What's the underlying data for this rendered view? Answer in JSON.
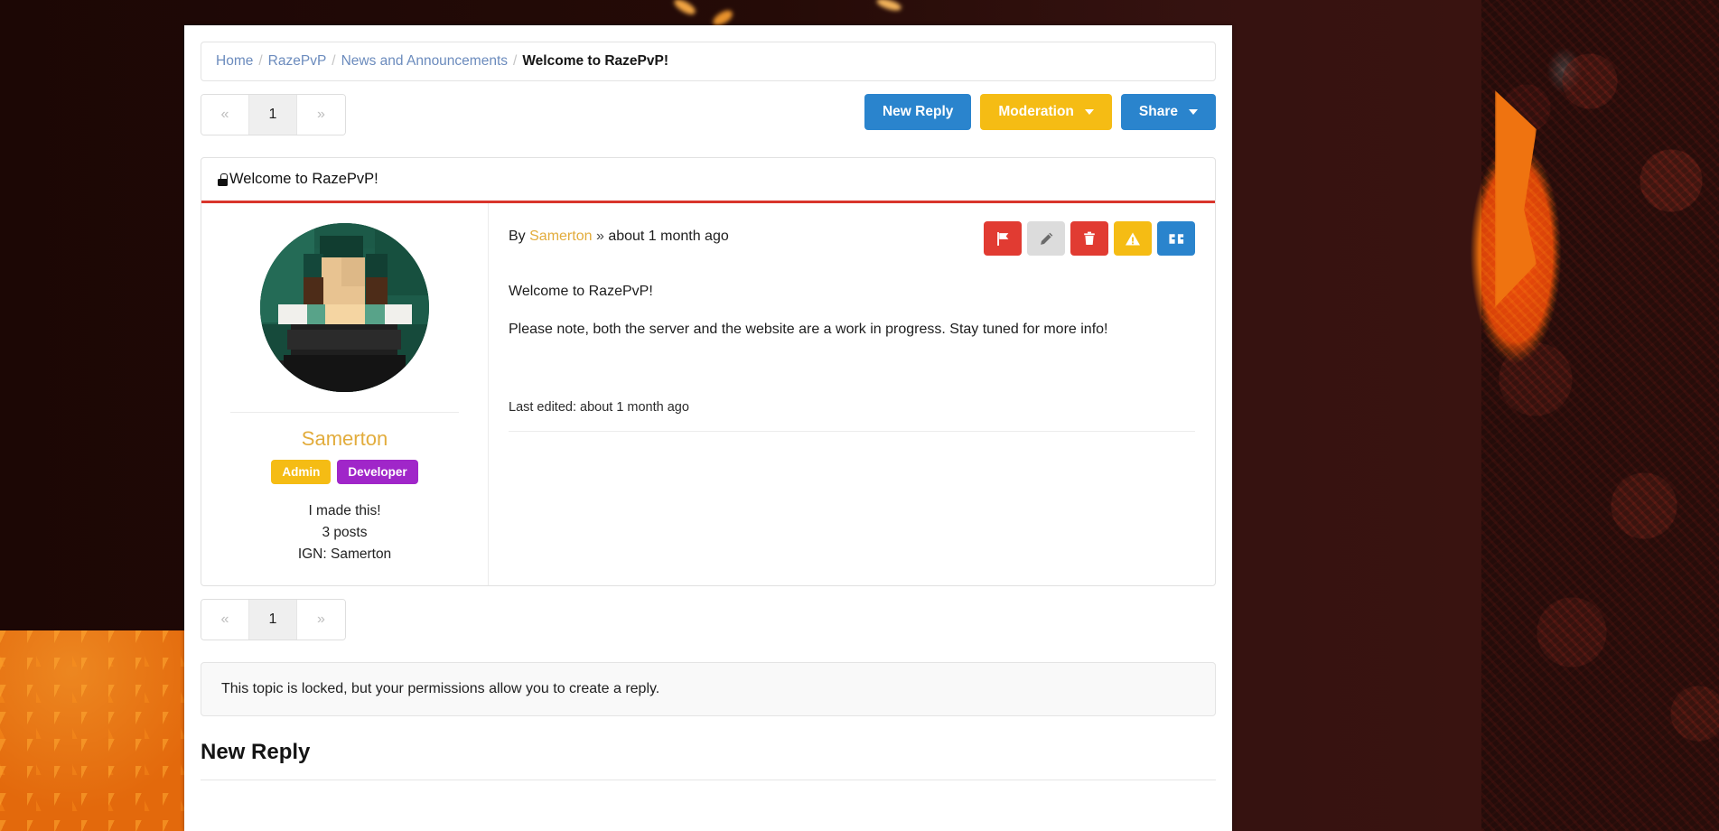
{
  "background": {
    "theme": "minecraft-nether",
    "colors": {
      "netherrack": "#3d1410",
      "lava": "#e3690c",
      "dark": "#230a06"
    }
  },
  "breadcrumb": {
    "name": "breadcrumb",
    "items": [
      {
        "label": "Home",
        "link": true
      },
      {
        "label": "RazePvP",
        "link": true
      },
      {
        "label": "News and Announcements",
        "link": true
      },
      {
        "label": "Welcome to RazePvP!",
        "link": false
      }
    ],
    "separator": "/"
  },
  "pagination": {
    "prev": "«",
    "next": "»",
    "pages": [
      "1"
    ],
    "active": "1"
  },
  "toolbar": {
    "new_reply_label": "New Reply",
    "moderation_label": "Moderation",
    "share_label": "Share",
    "colors": {
      "primary": "#2a84cd",
      "warning": "#f5bc14"
    }
  },
  "topic": {
    "title": "Welcome to RazePvP!",
    "locked_icon": "lock-icon",
    "accent_color": "#d9352c"
  },
  "post": {
    "byline_prefix": "By",
    "author": "Samerton",
    "byline_sep": "»",
    "timestamp": "about 1 month ago",
    "body": [
      "Welcome to RazePvP!",
      "Please note, both the server and the website are a work in progress. Stay tuned for more info!"
    ],
    "last_edited": "Last edited: about 1 month ago",
    "actions": [
      {
        "name": "flag-icon",
        "title": "Flag",
        "style": "act-red"
      },
      {
        "name": "pencil-icon",
        "title": "Edit",
        "style": "act-gray"
      },
      {
        "name": "trash-icon",
        "title": "Delete",
        "style": "act-blue-none"
      },
      {
        "name": "warning-icon",
        "title": "Warn",
        "style": "act-yellow"
      },
      {
        "name": "quote-icon",
        "title": "Quote",
        "style": "act-blue"
      }
    ]
  },
  "author_panel": {
    "avatar_alt": "Samerton avatar",
    "username": "Samerton",
    "username_color": "#e2ac3c",
    "badges": [
      {
        "label": "Admin",
        "color": "#f5bc14"
      },
      {
        "label": "Developer",
        "color": "#a026c9"
      }
    ],
    "tagline": "I made this!",
    "post_count": "3 posts",
    "ign": "IGN: Samerton"
  },
  "footer": {
    "locked_message": "This topic is locked, but your permissions allow you to create a reply.",
    "new_reply_heading": "New Reply"
  }
}
